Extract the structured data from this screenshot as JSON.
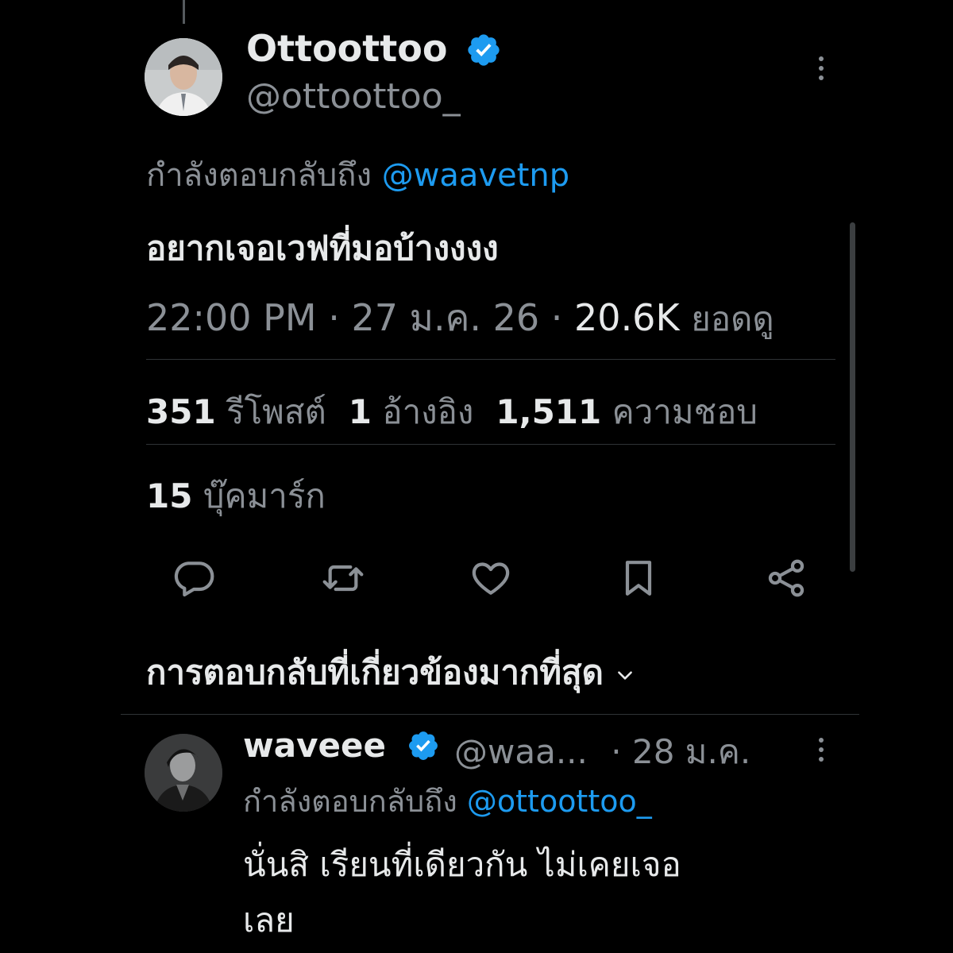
{
  "tweet": {
    "display_name": "Ottoottoo",
    "handle": "@ottoottoo_",
    "replying_prefix": "กำลังตอบกลับถึง",
    "replying_to": "@waavetnp",
    "text": "อยากเจอเวฟที่มอบ้างงงง",
    "time": "22:00 PM",
    "date": "27 ม.ค. 26",
    "views_count": "20.6K",
    "views_label": "ยอดดู",
    "separator": "·",
    "stats": {
      "retweets_count": "351",
      "retweets_label": "รีโพสต์",
      "quotes_count": "1",
      "quotes_label": "อ้างอิง",
      "likes_count": "1,511",
      "likes_label": "ความชอบ"
    },
    "bookmarks_count": "15",
    "bookmarks_label": "บุ๊คมาร์ก"
  },
  "actions": [
    {
      "icon": "reply-icon"
    },
    {
      "icon": "retweet-icon"
    },
    {
      "icon": "like-icon"
    },
    {
      "icon": "bookmark-icon"
    },
    {
      "icon": "share-icon"
    }
  ],
  "sort": {
    "label": "การตอบกลับที่เกี่ยวข้องมากที่สุด",
    "icon": "chevron-down-icon"
  },
  "reply": {
    "display_name": "waveee",
    "handle": "@waa...",
    "date": "28 ม.ค.",
    "separator": "·",
    "replying_prefix": "กำลังตอบกลับถึง",
    "replying_to": "@ottoottoo_",
    "text_line1": "นั่นสิ เรียนที่เดียวกัน ไม่เคยเจอ",
    "text_line2": "เลย"
  },
  "colors": {
    "background": "#000000",
    "primary_text": "#e7e9ea",
    "secondary_text": "#8b9096",
    "accent": "#1d9bf0",
    "divider": "#2f3336"
  }
}
